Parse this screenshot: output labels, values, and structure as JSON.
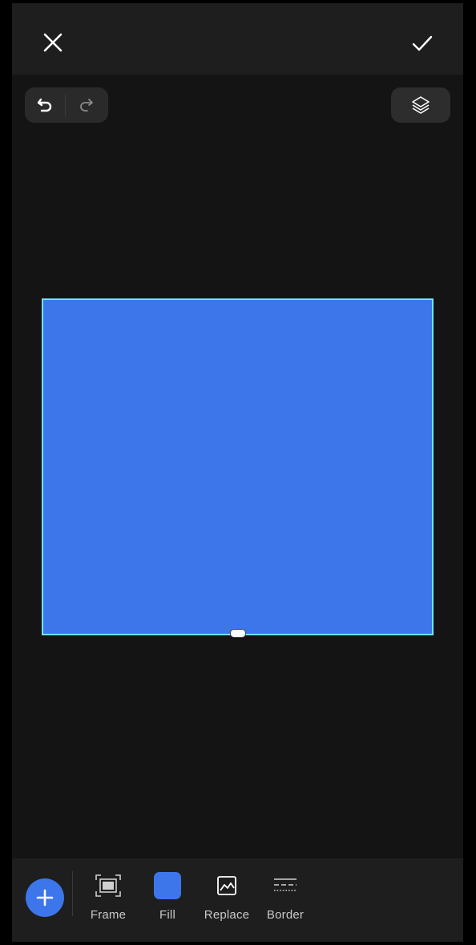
{
  "colors": {
    "accent": "#3c76ea",
    "selection_outline": "#6fe3f2",
    "background": "#141414",
    "bar": "#1e1e1e"
  },
  "topbar": {
    "close_icon": "close-icon",
    "confirm_icon": "checkmark-icon"
  },
  "history": {
    "undo_icon": "undo-icon",
    "redo_icon": "redo-icon"
  },
  "layers": {
    "icon": "layers-icon"
  },
  "toolbar": {
    "add_icon": "plus-icon",
    "tools": [
      {
        "label": "Frame",
        "icon": "frame-icon"
      },
      {
        "label": "Fill",
        "icon": "fill-swatch"
      },
      {
        "label": "Replace",
        "icon": "image-icon"
      },
      {
        "label": "Border",
        "icon": "border-style-icon"
      }
    ]
  }
}
